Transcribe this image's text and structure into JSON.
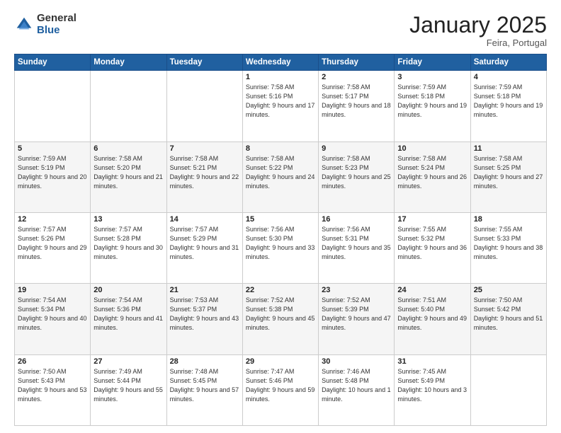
{
  "header": {
    "logo_general": "General",
    "logo_blue": "Blue",
    "month_title": "January 2025",
    "location": "Feira, Portugal"
  },
  "days_of_week": [
    "Sunday",
    "Monday",
    "Tuesday",
    "Wednesday",
    "Thursday",
    "Friday",
    "Saturday"
  ],
  "weeks": [
    [
      {
        "day": "",
        "sunrise": "",
        "sunset": "",
        "daylight": ""
      },
      {
        "day": "",
        "sunrise": "",
        "sunset": "",
        "daylight": ""
      },
      {
        "day": "",
        "sunrise": "",
        "sunset": "",
        "daylight": ""
      },
      {
        "day": "1",
        "sunrise": "Sunrise: 7:58 AM",
        "sunset": "Sunset: 5:16 PM",
        "daylight": "Daylight: 9 hours and 17 minutes."
      },
      {
        "day": "2",
        "sunrise": "Sunrise: 7:58 AM",
        "sunset": "Sunset: 5:17 PM",
        "daylight": "Daylight: 9 hours and 18 minutes."
      },
      {
        "day": "3",
        "sunrise": "Sunrise: 7:59 AM",
        "sunset": "Sunset: 5:18 PM",
        "daylight": "Daylight: 9 hours and 19 minutes."
      },
      {
        "day": "4",
        "sunrise": "Sunrise: 7:59 AM",
        "sunset": "Sunset: 5:18 PM",
        "daylight": "Daylight: 9 hours and 19 minutes."
      }
    ],
    [
      {
        "day": "5",
        "sunrise": "Sunrise: 7:59 AM",
        "sunset": "Sunset: 5:19 PM",
        "daylight": "Daylight: 9 hours and 20 minutes."
      },
      {
        "day": "6",
        "sunrise": "Sunrise: 7:58 AM",
        "sunset": "Sunset: 5:20 PM",
        "daylight": "Daylight: 9 hours and 21 minutes."
      },
      {
        "day": "7",
        "sunrise": "Sunrise: 7:58 AM",
        "sunset": "Sunset: 5:21 PM",
        "daylight": "Daylight: 9 hours and 22 minutes."
      },
      {
        "day": "8",
        "sunrise": "Sunrise: 7:58 AM",
        "sunset": "Sunset: 5:22 PM",
        "daylight": "Daylight: 9 hours and 24 minutes."
      },
      {
        "day": "9",
        "sunrise": "Sunrise: 7:58 AM",
        "sunset": "Sunset: 5:23 PM",
        "daylight": "Daylight: 9 hours and 25 minutes."
      },
      {
        "day": "10",
        "sunrise": "Sunrise: 7:58 AM",
        "sunset": "Sunset: 5:24 PM",
        "daylight": "Daylight: 9 hours and 26 minutes."
      },
      {
        "day": "11",
        "sunrise": "Sunrise: 7:58 AM",
        "sunset": "Sunset: 5:25 PM",
        "daylight": "Daylight: 9 hours and 27 minutes."
      }
    ],
    [
      {
        "day": "12",
        "sunrise": "Sunrise: 7:57 AM",
        "sunset": "Sunset: 5:26 PM",
        "daylight": "Daylight: 9 hours and 29 minutes."
      },
      {
        "day": "13",
        "sunrise": "Sunrise: 7:57 AM",
        "sunset": "Sunset: 5:28 PM",
        "daylight": "Daylight: 9 hours and 30 minutes."
      },
      {
        "day": "14",
        "sunrise": "Sunrise: 7:57 AM",
        "sunset": "Sunset: 5:29 PM",
        "daylight": "Daylight: 9 hours and 31 minutes."
      },
      {
        "day": "15",
        "sunrise": "Sunrise: 7:56 AM",
        "sunset": "Sunset: 5:30 PM",
        "daylight": "Daylight: 9 hours and 33 minutes."
      },
      {
        "day": "16",
        "sunrise": "Sunrise: 7:56 AM",
        "sunset": "Sunset: 5:31 PM",
        "daylight": "Daylight: 9 hours and 35 minutes."
      },
      {
        "day": "17",
        "sunrise": "Sunrise: 7:55 AM",
        "sunset": "Sunset: 5:32 PM",
        "daylight": "Daylight: 9 hours and 36 minutes."
      },
      {
        "day": "18",
        "sunrise": "Sunrise: 7:55 AM",
        "sunset": "Sunset: 5:33 PM",
        "daylight": "Daylight: 9 hours and 38 minutes."
      }
    ],
    [
      {
        "day": "19",
        "sunrise": "Sunrise: 7:54 AM",
        "sunset": "Sunset: 5:34 PM",
        "daylight": "Daylight: 9 hours and 40 minutes."
      },
      {
        "day": "20",
        "sunrise": "Sunrise: 7:54 AM",
        "sunset": "Sunset: 5:36 PM",
        "daylight": "Daylight: 9 hours and 41 minutes."
      },
      {
        "day": "21",
        "sunrise": "Sunrise: 7:53 AM",
        "sunset": "Sunset: 5:37 PM",
        "daylight": "Daylight: 9 hours and 43 minutes."
      },
      {
        "day": "22",
        "sunrise": "Sunrise: 7:52 AM",
        "sunset": "Sunset: 5:38 PM",
        "daylight": "Daylight: 9 hours and 45 minutes."
      },
      {
        "day": "23",
        "sunrise": "Sunrise: 7:52 AM",
        "sunset": "Sunset: 5:39 PM",
        "daylight": "Daylight: 9 hours and 47 minutes."
      },
      {
        "day": "24",
        "sunrise": "Sunrise: 7:51 AM",
        "sunset": "Sunset: 5:40 PM",
        "daylight": "Daylight: 9 hours and 49 minutes."
      },
      {
        "day": "25",
        "sunrise": "Sunrise: 7:50 AM",
        "sunset": "Sunset: 5:42 PM",
        "daylight": "Daylight: 9 hours and 51 minutes."
      }
    ],
    [
      {
        "day": "26",
        "sunrise": "Sunrise: 7:50 AM",
        "sunset": "Sunset: 5:43 PM",
        "daylight": "Daylight: 9 hours and 53 minutes."
      },
      {
        "day": "27",
        "sunrise": "Sunrise: 7:49 AM",
        "sunset": "Sunset: 5:44 PM",
        "daylight": "Daylight: 9 hours and 55 minutes."
      },
      {
        "day": "28",
        "sunrise": "Sunrise: 7:48 AM",
        "sunset": "Sunset: 5:45 PM",
        "daylight": "Daylight: 9 hours and 57 minutes."
      },
      {
        "day": "29",
        "sunrise": "Sunrise: 7:47 AM",
        "sunset": "Sunset: 5:46 PM",
        "daylight": "Daylight: 9 hours and 59 minutes."
      },
      {
        "day": "30",
        "sunrise": "Sunrise: 7:46 AM",
        "sunset": "Sunset: 5:48 PM",
        "daylight": "Daylight: 10 hours and 1 minute."
      },
      {
        "day": "31",
        "sunrise": "Sunrise: 7:45 AM",
        "sunset": "Sunset: 5:49 PM",
        "daylight": "Daylight: 10 hours and 3 minutes."
      },
      {
        "day": "",
        "sunrise": "",
        "sunset": "",
        "daylight": ""
      }
    ]
  ]
}
